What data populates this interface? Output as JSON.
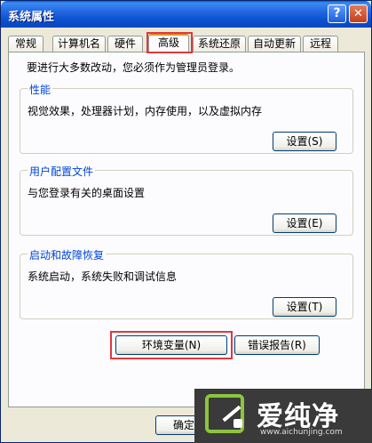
{
  "window": {
    "title": "系统属性",
    "help_label": "?",
    "close_label": "✕"
  },
  "tabs": [
    {
      "label": "常规"
    },
    {
      "label": "计算机名"
    },
    {
      "label": "硬件"
    },
    {
      "label": "高级"
    },
    {
      "label": "系统还原"
    },
    {
      "label": "自动更新"
    },
    {
      "label": "远程"
    }
  ],
  "active_tab": "高级",
  "panel": {
    "admin_note": "要进行大多数改动，您必须作为管理员登录。",
    "performance": {
      "title": "性能",
      "description": "视觉效果，处理器计划，内存使用，以及虚拟内存",
      "button": "设置(S)"
    },
    "user_profiles": {
      "title": "用户配置文件",
      "description": "与您登录有关的桌面设置",
      "button": "设置(E)"
    },
    "startup_recovery": {
      "title": "启动和故障恢复",
      "description": "系统启动，系统失败和调试信息",
      "button": "设置(T)"
    },
    "env_button": "环境变量(N)",
    "error_report_button": "错误报告(R)"
  },
  "footer": {
    "ok_button": "确定"
  },
  "watermark": {
    "text": "爱纯净",
    "url": "www.aichunjing.com"
  },
  "colors": {
    "highlight": "#e0393e",
    "group_title": "#0046d5",
    "titlebar": "#0b52d1"
  }
}
